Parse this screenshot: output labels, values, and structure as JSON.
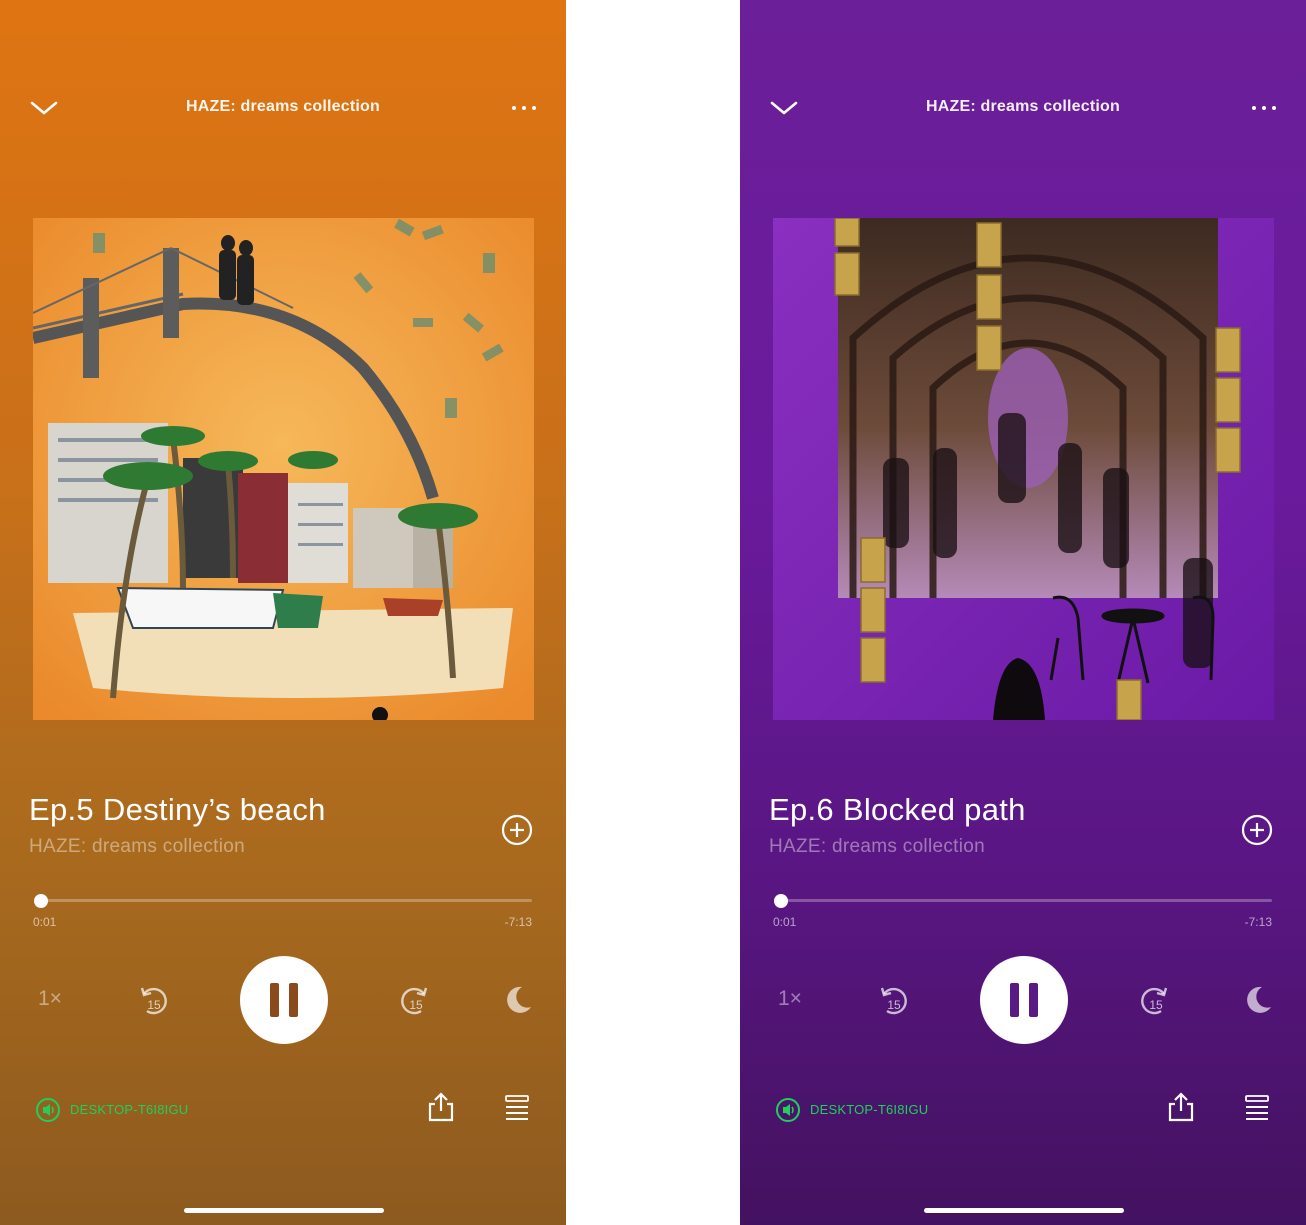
{
  "left": {
    "header_title": "HAZE: dreams collection",
    "episode_title": "Ep.5 Destiny’s beach",
    "show_name": "HAZE: dreams collection",
    "elapsed": "0:01",
    "remaining": "-7:13",
    "speed": "1×",
    "skip_back": "15",
    "skip_forward": "15",
    "device": "DESKTOP-T6I8IGU",
    "progress_fraction": 0.002,
    "colors": {
      "accent": "#1fd05a",
      "bg_top": "#df7412",
      "bg_bottom": "#8d5a1f"
    }
  },
  "right": {
    "header_title": "HAZE: dreams collection",
    "episode_title": "Ep.6 Blocked path",
    "show_name": "HAZE: dreams collection",
    "elapsed": "0:01",
    "remaining": "-7:13",
    "speed": "1×",
    "skip_back": "15",
    "skip_forward": "15",
    "device": "DESKTOP-T6I8IGU",
    "progress_fraction": 0.002,
    "colors": {
      "accent": "#1fd05a",
      "bg_top": "#6b1f98",
      "bg_bottom": "#43125f"
    }
  },
  "icons": [
    "chevron-down-icon",
    "more-icon",
    "add-circle-icon",
    "rewind-15-icon",
    "pause-icon",
    "forward-15-icon",
    "moon-icon",
    "speaker-icon",
    "share-icon",
    "queue-icon"
  ]
}
